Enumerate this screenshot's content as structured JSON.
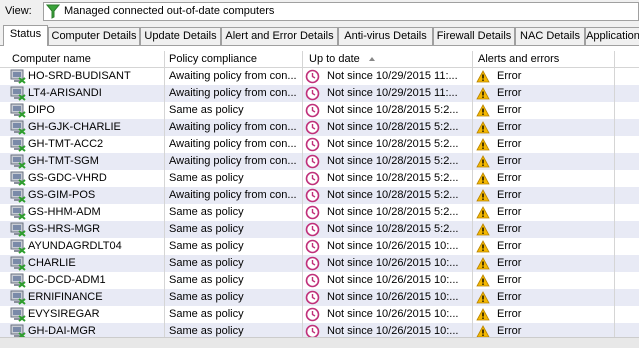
{
  "view": {
    "label": "View:",
    "value": "Managed connected out-of-date computers"
  },
  "tabs": [
    "Status",
    "Computer Details",
    "Update Details",
    "Alert and Error Details",
    "Anti-virus Details",
    "Firewall Details",
    "NAC Details",
    "Application"
  ],
  "columns": [
    "Computer name",
    "Policy compliance",
    "Up to date",
    "Alerts and errors"
  ],
  "rows": [
    {
      "name": "HO-SRD-BUDISANT",
      "policy": "Awaiting policy from con...",
      "date": "Not since 10/29/2015 11:...",
      "alert": "Error"
    },
    {
      "name": "LT4-ARISANDI",
      "policy": "Awaiting policy from con...",
      "date": "Not since 10/29/2015 11:...",
      "alert": "Error"
    },
    {
      "name": "DIPO",
      "policy": "Same as policy",
      "date": "Not since 10/28/2015 5:2...",
      "alert": "Error"
    },
    {
      "name": "GH-GJK-CHARLIE",
      "policy": "Awaiting policy from con...",
      "date": "Not since 10/28/2015 5:2...",
      "alert": "Error"
    },
    {
      "name": "GH-TMT-ACC2",
      "policy": "Awaiting policy from con...",
      "date": "Not since 10/28/2015 5:2...",
      "alert": "Error"
    },
    {
      "name": "GH-TMT-SGM",
      "policy": "Awaiting policy from con...",
      "date": "Not since 10/28/2015 5:2...",
      "alert": "Error"
    },
    {
      "name": "GS-GDC-VHRD",
      "policy": "Same as policy",
      "date": "Not since 10/28/2015 5:2...",
      "alert": "Error"
    },
    {
      "name": "GS-GIM-POS",
      "policy": "Awaiting policy from con...",
      "date": "Not since 10/28/2015 5:2...",
      "alert": "Error"
    },
    {
      "name": "GS-HHM-ADM",
      "policy": "Same as policy",
      "date": "Not since 10/28/2015 5:2...",
      "alert": "Error"
    },
    {
      "name": "GS-HRS-MGR",
      "policy": "Same as policy",
      "date": "Not since 10/28/2015 5:2...",
      "alert": "Error"
    },
    {
      "name": "AYUNDAGRDLT04",
      "policy": "Same as policy",
      "date": "Not since 10/26/2015 10:...",
      "alert": "Error"
    },
    {
      "name": "CHARLIE",
      "policy": "Same as policy",
      "date": "Not since 10/26/2015 10:...",
      "alert": "Error"
    },
    {
      "name": "DC-DCD-ADM1",
      "policy": "Same as policy",
      "date": "Not since 10/26/2015 10:...",
      "alert": "Error"
    },
    {
      "name": "ERNIFINANCE",
      "policy": "Same as policy",
      "date": "Not since 10/26/2015 10:...",
      "alert": "Error"
    },
    {
      "name": "EVYSIREGAR",
      "policy": "Same as policy",
      "date": "Not since 10/26/2015 10:...",
      "alert": "Error"
    },
    {
      "name": "GH-DAI-MGR",
      "policy": "Same as policy",
      "date": "Not since 10/26/2015 10:...",
      "alert": "Error"
    }
  ],
  "icons": {
    "row_computer": "computer-out-of-date-icon",
    "row_date": "clock-icon",
    "row_alert": "warning-icon",
    "filter": "filter-icon"
  },
  "colors": {
    "alt_row": "#e8eaf5",
    "clock": "#c0307a",
    "warning": "#f5b800"
  }
}
